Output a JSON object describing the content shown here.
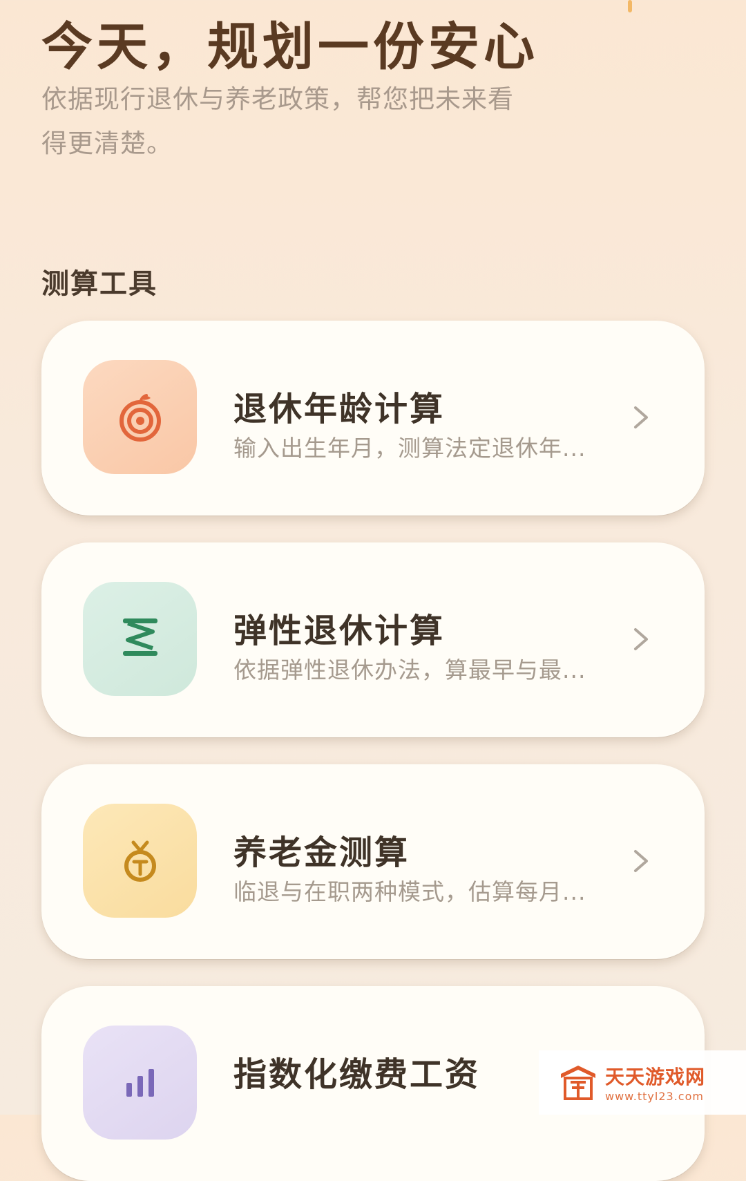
{
  "hero": {
    "title": "今天，规划一份安心",
    "subtitle": "依据现行退休与养老政策，帮您把未来看得更清楚。"
  },
  "section": {
    "title": "测算工具"
  },
  "tools": [
    {
      "icon": "target-icon",
      "title": "退休年龄计算",
      "desc": "输入出生年月，测算法定退休年...",
      "icon_bg": "#fbd2b5",
      "icon_color": "#e2663b"
    },
    {
      "icon": "spring-icon",
      "title": "弹性退休计算",
      "desc": "依据弹性退休办法，算最早与最...",
      "icon_bg": "#d5ece0",
      "icon_color": "#2f8a5c"
    },
    {
      "icon": "money-bag-icon",
      "title": "养老金测算",
      "desc": "临退与在职两种模式，估算每月...",
      "icon_bg": "#fbe2a8",
      "icon_color": "#c58a1e"
    },
    {
      "icon": "indexed-wage-icon",
      "title": "指数化缴费工资",
      "desc": "",
      "icon_bg": "#e3dcf2",
      "icon_color": "#7a68b8"
    }
  ],
  "watermark": {
    "name": "天天游戏网",
    "url": "www.ttyl23.com"
  },
  "colors": {
    "background": "#f8eadc",
    "title_brown": "#5a3a22",
    "card_bg": "#fffdf7"
  }
}
